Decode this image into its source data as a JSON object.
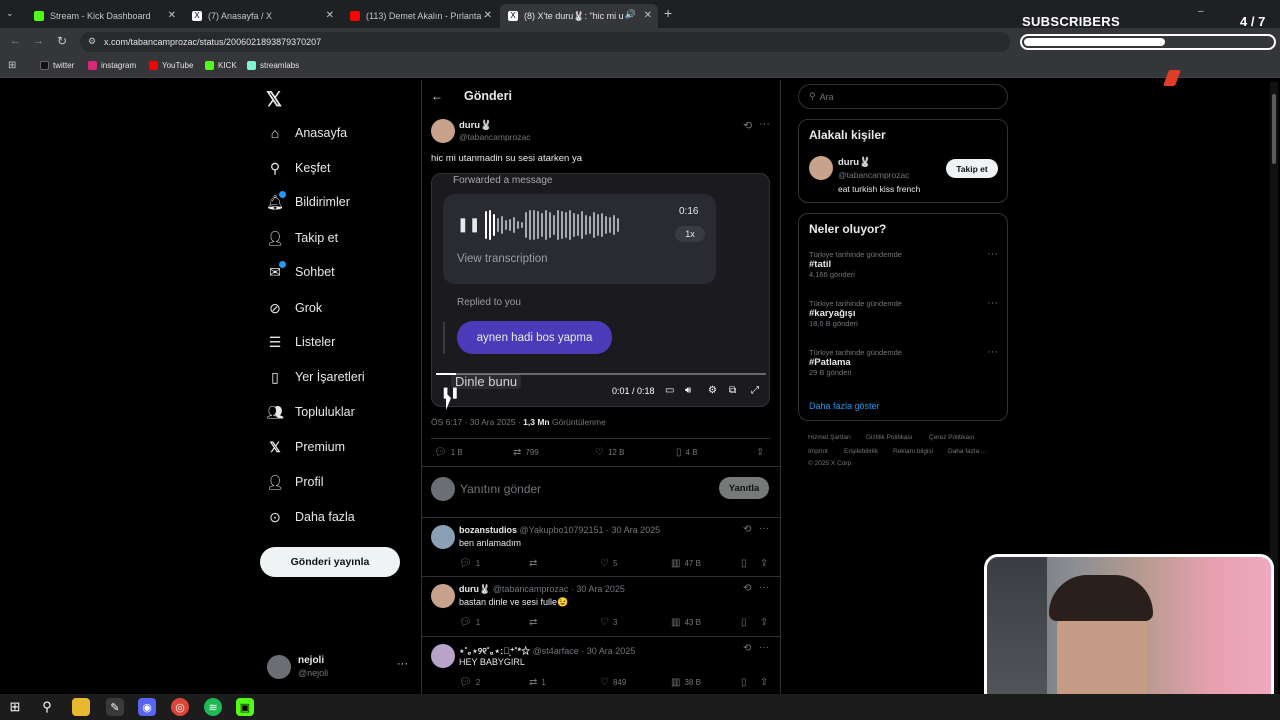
{
  "browser": {
    "tabs": [
      {
        "label": "Stream - Kick Dashboard",
        "color": "#53fc18"
      },
      {
        "label": "(7) Anasayfa / X",
        "color": "#ffffff"
      },
      {
        "label": "(113) Demet Akalın - Pırlanta -",
        "color": "#ff0000"
      },
      {
        "label": "(8) X'te duru🐰: \"hic mi uta",
        "color": "#ffffff"
      }
    ],
    "url": "x.com/tabancamprozac/status/2006021893879370207",
    "bookmarks": [
      "twitter",
      "instagram",
      "YouTube",
      "KICK",
      "streamlabs"
    ]
  },
  "overlay": {
    "subscribers_label": "SUBSCRIBERS",
    "subscribers_count": "4 / 7",
    "subscribers_progress": 0.57
  },
  "nav": {
    "items": [
      {
        "label": "Anasayfa",
        "icon": "home-icon"
      },
      {
        "label": "Keşfet",
        "icon": "search-icon"
      },
      {
        "label": "Bildirimler",
        "icon": "bell-icon"
      },
      {
        "label": "Takip et",
        "icon": "follow-icon"
      },
      {
        "label": "Sohbet",
        "icon": "mail-icon"
      },
      {
        "label": "Grok",
        "icon": "grok-icon"
      },
      {
        "label": "Listeler",
        "icon": "list-icon"
      },
      {
        "label": "Yer İşaretleri",
        "icon": "bookmark-icon"
      },
      {
        "label": "Topluluklar",
        "icon": "communities-icon"
      },
      {
        "label": "Premium",
        "icon": "x-icon"
      },
      {
        "label": "Profil",
        "icon": "profile-icon"
      },
      {
        "label": "Daha fazla",
        "icon": "more-icon"
      }
    ],
    "post_button": "Gönderi yayınla",
    "account": {
      "name": "nejoli",
      "handle": "@nejoli"
    }
  },
  "header": {
    "title": "Gönderi"
  },
  "post": {
    "author": "duru🐰",
    "handle": "@tabancamprozac",
    "text": "hic mi utanmadin su sesi atarken ya",
    "video": {
      "forwarded": "Forwarded a message",
      "voice_time": "0:16",
      "speed": "1x",
      "view_transcription": "View transcription",
      "replied_to": "Replied to you",
      "reply_bubble": "aynen hadi bos yapma",
      "listen": "Dinle bunu",
      "time": "0:01 / 0:18",
      "progress": 0.06
    },
    "meta_time": "ÖS 6:17 · 30 Ara 2025 · ",
    "views_count": "1,3 Mn",
    "views_label": " Görüntülenme",
    "stats": {
      "replies": "1 B",
      "reposts": "799",
      "likes": "12 B",
      "bookmarks": "4 B"
    },
    "reply_placeholder": "Yanıtını gönder",
    "reply_button": "Yanıtla"
  },
  "replies": [
    {
      "name": "bozanstudios",
      "handle": "@Yakupbo10792151 · 30 Ara 2025",
      "text": "ben anlamadım",
      "replies": "1",
      "reposts": "",
      "likes": "5",
      "views": "47 B",
      "avatar": "#8aa0b4"
    },
    {
      "name": "duru🐰",
      "handle": "@tabancamprozac · 30 Ara 2025",
      "text": "bastan dinle ve sesi fulle😉",
      "replies": "1",
      "reposts": "",
      "likes": "3",
      "views": "43 B",
      "avatar": "#c8a28a"
    },
    {
      "name": "⋆˚｡⋆୨୧˚｡⋆:‧͙⁺˚*☆",
      "handle": "@st4arface · 30 Ara 2025",
      "text": "HEY BABYGIRL",
      "replies": "2",
      "reposts": "1",
      "likes": "849",
      "views": "38 B",
      "avatar": "#b9a3c9"
    }
  ],
  "sidebar": {
    "search_placeholder": "Ara",
    "related_title": "Alakalı kişiler",
    "related_person": {
      "name": "duru🐰",
      "handle": "@tabancamprozac",
      "bio": "eat turkish kiss french",
      "button": "Takip et"
    },
    "trends_title": "Neler oluyor?",
    "trends": [
      {
        "meta": "Türkiye tarihinde gündemde",
        "tag": "#tatil",
        "count": "4.166 gönderi"
      },
      {
        "meta": "Türkiye tarihinde gündemde",
        "tag": "#karyağışı",
        "count": "18,6 B gönderi"
      },
      {
        "meta": "Türkiye tarihinde gündemde",
        "tag": "#Patlama",
        "count": "29 B gönderi"
      }
    ],
    "show_more": "Daha fazla göster",
    "footer": [
      "Hizmet Şartları",
      "Gizlilik Politikası",
      "Çerez Politikası",
      "Imprint",
      "Erişilebilirlik",
      "Reklam bilgisi",
      "Daha fazla ...",
      "© 2025 X Corp."
    ]
  }
}
